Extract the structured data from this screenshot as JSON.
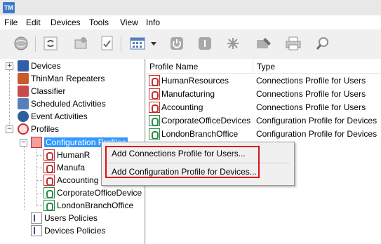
{
  "app": {
    "icon_text": "TM"
  },
  "menu": [
    "File",
    "Edit",
    "Devices",
    "Tools",
    "View",
    "Info"
  ],
  "toolbar": {
    "buttons": [
      "globe-icon",
      "refresh-icon",
      "wizard-icon",
      "checklist-icon",
      "grid-view-icon",
      "dropdown-arrow-icon",
      "power-icon",
      "info-icon",
      "asterisk-icon",
      "tools-icon",
      "print-icon",
      "search-icon"
    ]
  },
  "tree": {
    "devices": "Devices",
    "repeaters": "ThinMan Repeaters",
    "classifier": "Classifier",
    "scheduled": "Scheduled Activities",
    "events": "Event Activities",
    "profiles": "Profiles",
    "config_profiles": "Configuration Profiles",
    "child1": "HumanR",
    "child2": "Manufa",
    "child3": "Accounting",
    "child4": "CorporateOfficeDevice",
    "child5": "LondonBranchOffice",
    "users_policies": "Users Policies",
    "devices_policies": "Devices Policies"
  },
  "list": {
    "col_name": "Profile Name",
    "col_type": "Type",
    "rows": [
      {
        "name": "HumanResources",
        "type": "Connections Profile for Users"
      },
      {
        "name": "Manufacturing",
        "type": "Connections Profile for Users"
      },
      {
        "name": "Accounting",
        "type": "Connections Profile for Users"
      },
      {
        "name": "CorporateOfficeDevices",
        "type": "Configuration Profile for Devices"
      },
      {
        "name": "LondonBranchOffice",
        "type": "Configuration Profile for Devices"
      }
    ]
  },
  "context_menu": {
    "item1": "Add Connections Profile for Users...",
    "item2": "Add Configuration Profile for Devices..."
  },
  "colors": {
    "highlight": "#e01010",
    "selection": "#3399ff"
  }
}
